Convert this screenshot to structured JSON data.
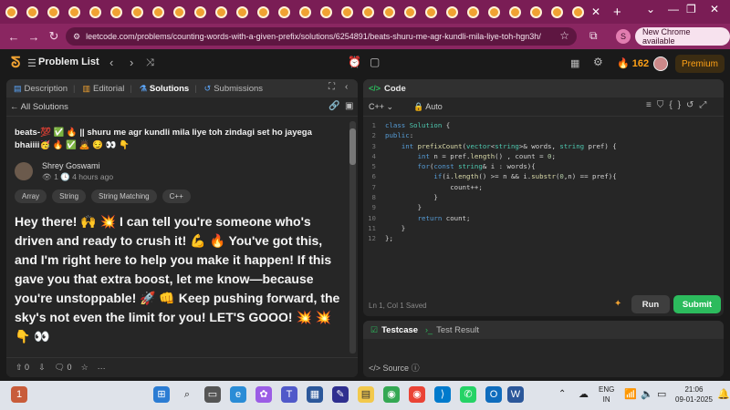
{
  "browser": {
    "tab_count": 28,
    "tab_close": "✕",
    "tab_add": "+",
    "window_controls": [
      "⌄",
      "—",
      "❐",
      "✕"
    ],
    "url": "leetcode.com/problems/counting-words-with-a-given-prefix/solutions/6254891/beats-shuru-me-agr-kundli-mila-liye-toh-hgn3h/",
    "profile_initial": "S",
    "update_label": "New Chrome available",
    "colors": {
      "tabstrip": "#7a1d55",
      "addressbar": "#8a2661"
    }
  },
  "topbar": {
    "problem_list": "Problem List",
    "streak": "162",
    "premium": "Premium"
  },
  "left": {
    "tabs": [
      {
        "label": "Description",
        "icon": "description-icon"
      },
      {
        "label": "Editorial",
        "icon": "book-icon"
      },
      {
        "label": "Solutions",
        "icon": "flask-icon"
      },
      {
        "label": "Submissions",
        "icon": "history-icon"
      }
    ],
    "back_label": "All Solutions",
    "title": "beats-💯 ✅ 🔥 || shuru me agr kundli mila liye toh zindagi set ho jayega bhaiiii🥳 🔥 ✅ 🙇 😏 👀 👇",
    "author": "Shrey Goswami",
    "meta": "👁 1    🕓 4 hours ago",
    "tags": [
      "Array",
      "String",
      "String Matching",
      "C++"
    ],
    "body": "Hey there! 🙌 💥 I can tell you're someone who's driven and ready to crush it! 💪 🔥 You've got this, and I'm right here to help you make it happen! If this gave you that extra boost, let me know—because you're unstoppable! 🚀 👊 Keep pushing forward, the sky's not even the limit for you! LET'S GOOO! 💥 💥 👇 👀",
    "upvotes": "0",
    "comments": "0"
  },
  "editor": {
    "title": "Code",
    "language": "C++",
    "mode": "Auto",
    "status": "Ln 1, Col 1    Saved",
    "run": "Run",
    "submit": "Submit",
    "code_lines": [
      "class Solution {",
      "public:",
      "    int prefixCount(vector<string>& words, string pref) {",
      "        int n = pref.length() , count = 0;",
      "        for(const string& i : words){",
      "            if(i.length() >= n && i.substr(0,n) == pref){",
      "                count++;",
      "            }",
      "        }",
      "        return count;",
      "    }",
      "};"
    ]
  },
  "testpanel": {
    "tabs": [
      "Testcase",
      "Test Result"
    ],
    "source": "Source"
  },
  "taskbar": {
    "notification_badge": "1",
    "language": "ENG",
    "region": "IN",
    "time": "21:06",
    "date": "09-01-2025"
  }
}
